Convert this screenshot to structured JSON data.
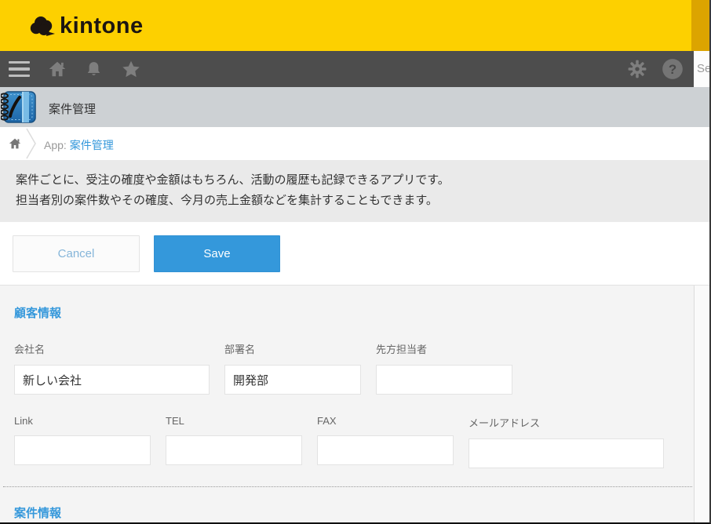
{
  "topbar": {
    "logo_text": "kintone"
  },
  "navbar": {
    "icons_left": [
      "hamburger-menu",
      "home",
      "notifications-bell",
      "favorites-star"
    ],
    "icons_right": [
      "settings-gear",
      "help-question"
    ],
    "search_visible_text": "Se"
  },
  "app_header": {
    "title": "案件管理",
    "icon": "notebook-app-icon"
  },
  "breadcrumb": {
    "home_icon": "home-icon",
    "prefix": "App: ",
    "app_link": "案件管理"
  },
  "description": {
    "line1": "案件ごとに、受注の確度や金額はもちろん、活動の履歴も記録できるアプリです。",
    "line2": "担当者別の案件数やその確度、今月の売上金額などを集計することもできます。"
  },
  "actions": {
    "cancel_label": "Cancel",
    "save_label": "Save"
  },
  "form": {
    "sections": [
      {
        "title": "顧客情報",
        "rows": [
          {
            "fields": [
              {
                "label": "会社名",
                "value": "新しい会社"
              },
              {
                "label": "部署名",
                "value": "開発部"
              },
              {
                "label": "先方担当者",
                "value": ""
              }
            ]
          },
          {
            "fields": [
              {
                "label": "Link",
                "value": ""
              },
              {
                "label": "TEL",
                "value": ""
              },
              {
                "label": "FAX",
                "value": ""
              },
              {
                "label": "メールアドレス",
                "value": ""
              }
            ]
          }
        ]
      },
      {
        "title": "案件情報"
      }
    ]
  },
  "colors": {
    "brand_yellow": "#FDD000",
    "brand_yellow_dark": "#DCA400",
    "navbar_gray": "#4D4D4D",
    "primary_blue": "#3498DB",
    "link_blue": "#3598DB",
    "section_title_blue": "#3598DB",
    "app_header_gray": "#CDD1D4",
    "description_gray": "#EAEAEA",
    "form_background": "#F4F4F4"
  }
}
